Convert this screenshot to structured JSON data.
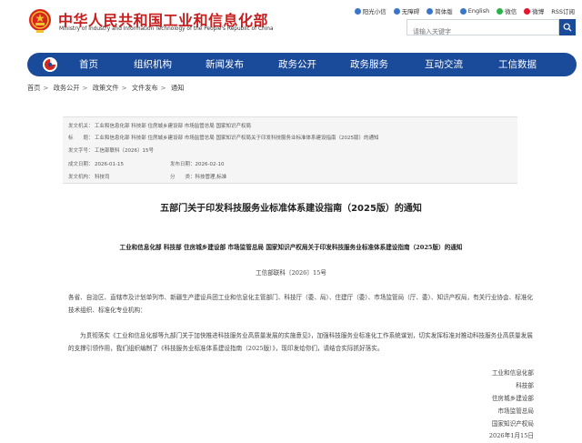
{
  "header": {
    "site_title_cn": "中华人民共和国工业和信息化部",
    "site_title_en": "Ministry of Industry and Information Technology of the People's Republic of China",
    "top_links": [
      "阳光小信",
      "无障碍",
      "简体版",
      "English",
      "微信",
      "微博",
      "RSS订阅"
    ],
    "search_placeholder": "请输入关键字"
  },
  "nav": {
    "items": [
      "首页",
      "组织机构",
      "新闻发布",
      "政务公开",
      "政务服务",
      "互动交流",
      "工信数据"
    ]
  },
  "breadcrumb": [
    "首页",
    "政务公开",
    "政策文件",
    "文件发布",
    "通知"
  ],
  "meta": {
    "issuer_label": "发文机关：",
    "issuer": "工业和信息化部 科技部 住房城乡建设部 市场监管总局 国家知识产权局",
    "subject_label": "标　　题：",
    "subject": "工业和信息化部 科技部 住房城乡建设部 市场监管总局 国家知识产权局关于印发科技服务业标准体系建设指南（2025版）的通知",
    "docno_label": "发文字号：",
    "docno": "工信部联科〔2026〕15号",
    "date_label": "成文日期：",
    "date": "2026-01-15",
    "pub_label": "发布日期：",
    "pub_date": "2026-02-10",
    "dept_label": "发文机构：",
    "dept": "科技司",
    "cat_label": "分　　类：",
    "category": "科技管理,标准"
  },
  "doc": {
    "title": "五部门关于印发科技服务业标准体系建设指南（2025版）的通知",
    "subtitle": "工业和信息化部 科技部 住房城乡建设部 市场监管总局 国家知识产权局关于印发科技服务业标准体系建设指南（2025版）的通知",
    "doc_no": "工信部联科〔2026〕15号",
    "para1": "各省、自治区、直辖市及计划单列市、新疆生产建设兵团工业和信息化主管部门、科技厅（委、局）、住建厅（委）、市场监管局（厅、委）、知识产权局，有关行业协会、标准化技术组织、标准化专业机构：",
    "para2": "为贯彻落实《工业和信息化部等九部门关于加快推进科技服务业高质量发展的实施意见》，加强科技服务业标准化工作系统谋划，切实发挥标准对推动科技服务业高质量发展的支撑引领作用，我们组织编制了《科技服务业标准体系建设指南（2025版）》，现印发给你们，请结合实际抓好落实。",
    "signers": [
      "工业和信息化部",
      "科技部",
      "住房城乡建设部",
      "市场监管总局",
      "国家知识产权局",
      "2026年1月15日"
    ]
  }
}
